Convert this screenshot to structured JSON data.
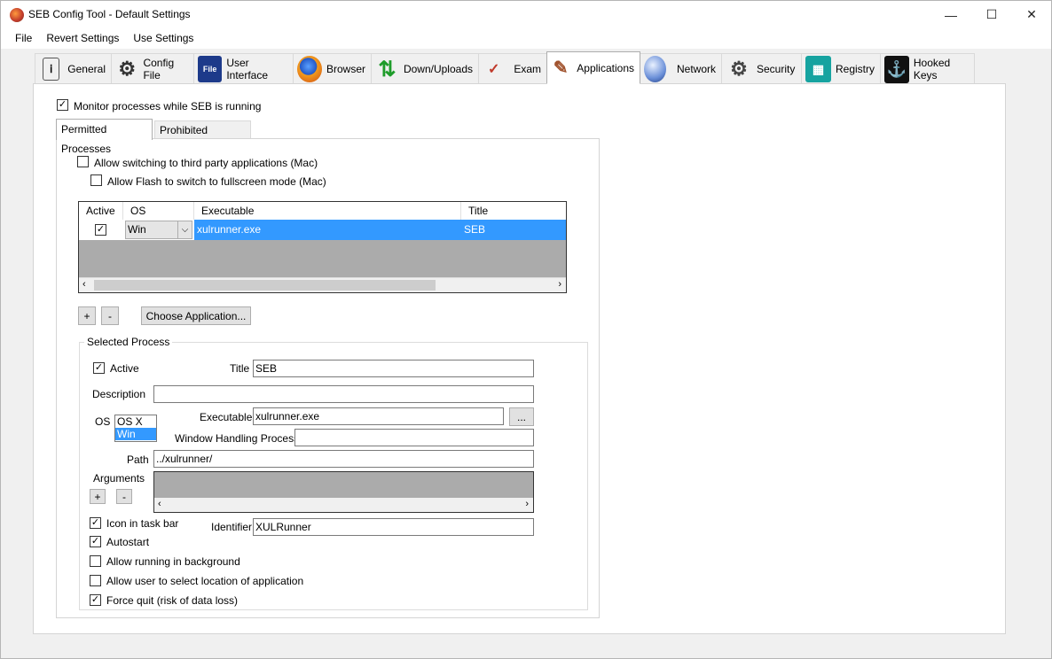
{
  "window": {
    "title": "SEB Config Tool - Default Settings",
    "minimize": "—",
    "maximize": "☐",
    "close": "✕"
  },
  "menu": {
    "file": "File",
    "revert": "Revert Settings",
    "use": "Use Settings"
  },
  "tabs": {
    "general": "General",
    "config_file": "Config File",
    "user_interface": "User Interface",
    "browser": "Browser",
    "down_uploads": "Down/Uploads",
    "exam": "Exam",
    "applications": "Applications",
    "network": "Network",
    "security": "Security",
    "registry": "Registry",
    "hooked_keys": "Hooked Keys"
  },
  "applications": {
    "monitor_label": "Monitor processes while SEB is running",
    "permitted_tab": "Permitted Processes",
    "prohibited_tab": "Prohibited Processes",
    "allow_switch_label": "Allow switching to third party applications (Mac)",
    "allow_flash_label": "Allow Flash to switch to fullscreen mode (Mac)",
    "grid": {
      "headers": {
        "active": "Active",
        "os": "OS",
        "executable": "Executable",
        "title": "Title"
      },
      "row": {
        "active": "✓",
        "os": "Win",
        "executable": "xulrunner.exe",
        "title": "SEB"
      }
    },
    "add_button": "+",
    "remove_button": "-",
    "choose_button": "Choose Application...",
    "selected": {
      "group_title": "Selected Process",
      "active_label": "Active",
      "title_label": "Title",
      "title_value": "SEB",
      "description_label": "Description",
      "description_value": "",
      "os_label": "OS",
      "os_option_1": "OS X",
      "os_option_2": "Win",
      "executable_label": "Executable",
      "executable_value": "xulrunner.exe",
      "browse_button": "...",
      "window_handling_label": "Window Handling Process",
      "window_handling_value": "",
      "path_label": "Path",
      "path_value": "../xulrunner/",
      "arguments_label": "Arguments",
      "args_add": "+",
      "args_remove": "-",
      "icon_taskbar_label": "Icon in task bar",
      "identifier_label": "Identifier",
      "identifier_value": "XULRunner",
      "autostart_label": "Autostart",
      "background_label": "Allow running in background",
      "select_location_label": "Allow user to select location of application",
      "force_quit_label": "Force quit (risk of data loss)"
    }
  }
}
